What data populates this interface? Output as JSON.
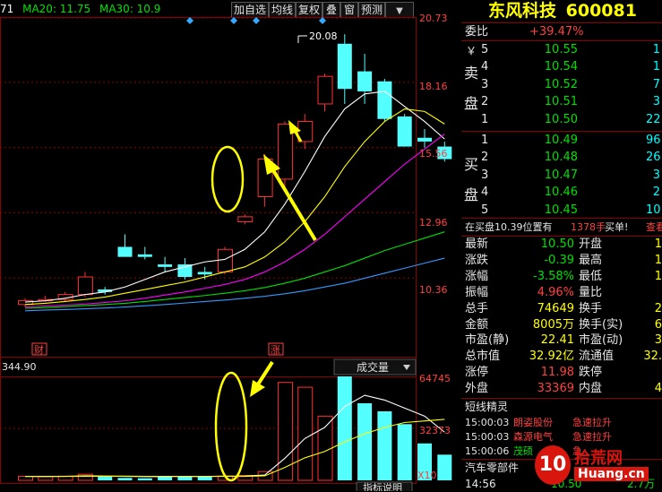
{
  "toolbar": {
    "ma_prefix": "71",
    "ma20": "MA20: 11.75",
    "ma30": "MA30: 10.9",
    "buttons": [
      "加自选",
      "均线",
      "复权",
      "叠",
      "窗",
      "预测"
    ],
    "dropdown_icon": "triangle-down-icon"
  },
  "price_axis": [
    "20.73",
    "18.16",
    "15.56",
    "12.96",
    "10.36"
  ],
  "high_label": "20.08",
  "markers": {
    "cai": "财",
    "zhang": "涨"
  },
  "volume": {
    "left_value": "344.90",
    "indicator": "成交量",
    "axis": [
      "64745",
      "32373",
      "X10"
    ],
    "bottom_tab": "指标说明"
  },
  "chart_data": {
    "type": "candlestick",
    "ohlc": [
      [
        9.3,
        9.55,
        9.2,
        9.45
      ],
      [
        9.45,
        9.65,
        9.4,
        9.5
      ],
      [
        9.5,
        9.8,
        9.4,
        9.7
      ],
      [
        9.7,
        10.6,
        9.6,
        10.4
      ],
      [
        9.9,
        10.0,
        9.7,
        9.8
      ],
      [
        11.6,
        12.1,
        11.3,
        11.2
      ],
      [
        11.3,
        11.6,
        11.1,
        11.2
      ],
      [
        10.9,
        11.2,
        10.6,
        10.8
      ],
      [
        10.9,
        11.15,
        10.3,
        10.4
      ],
      [
        10.6,
        10.8,
        10.3,
        10.5
      ],
      [
        10.6,
        11.6,
        10.5,
        11.5
      ],
      [
        12.6,
        12.9,
        12.5,
        12.8
      ],
      [
        13.6,
        15.3,
        13.2,
        15.1
      ],
      [
        14.3,
        16.6,
        13.9,
        16.5
      ],
      [
        15.8,
        16.9,
        15.5,
        16.6
      ],
      [
        17.3,
        18.5,
        17.0,
        18.4
      ],
      [
        19.7,
        20.08,
        17.3,
        17.9
      ],
      [
        18.6,
        19.3,
        17.3,
        17.8
      ],
      [
        18.2,
        18.3,
        16.6,
        16.7
      ],
      [
        16.8,
        16.9,
        15.6,
        15.6
      ],
      [
        15.95,
        16.3,
        15.55,
        15.8
      ],
      [
        15.6,
        15.8,
        15.0,
        15.1
      ]
    ],
    "volume": [
      2500,
      2300,
      2600,
      3800,
      2200,
      1500,
      1300,
      2800,
      2700,
      2500,
      2600,
      3000,
      5500,
      61000,
      58000,
      40000,
      64745,
      48000,
      43000,
      35000,
      23000,
      16000
    ],
    "ma_price": [
      {
        "name": "MA5",
        "color": "#ffffff",
        "values": [
          9.4,
          9.45,
          9.55,
          9.7,
          9.8,
          10.0,
          10.3,
          10.6,
          10.8,
          11.0,
          11.1,
          11.5,
          12.2,
          13.3,
          14.6,
          16.0,
          17.1,
          17.7,
          17.8,
          17.2,
          16.6,
          15.9
        ]
      },
      {
        "name": "MA10",
        "color": "#ffff00",
        "values": [
          9.3,
          9.35,
          9.42,
          9.5,
          9.6,
          9.75,
          9.9,
          10.05,
          10.2,
          10.4,
          10.6,
          10.8,
          11.2,
          11.8,
          12.6,
          13.6,
          14.8,
          15.8,
          16.6,
          17.1,
          17.0,
          16.5
        ]
      },
      {
        "name": "MA20",
        "color": "#ff00ff",
        "values": [
          9.2,
          9.24,
          9.28,
          9.32,
          9.38,
          9.45,
          9.55,
          9.68,
          9.8,
          9.95,
          10.1,
          10.3,
          10.6,
          11.0,
          11.5,
          12.1,
          12.8,
          13.5,
          14.2,
          14.9,
          15.5,
          16.1
        ]
      },
      {
        "name": "MA30",
        "color": "#00e000",
        "values": [
          9.15,
          9.18,
          9.22,
          9.26,
          9.3,
          9.35,
          9.42,
          9.5,
          9.58,
          9.66,
          9.75,
          9.85,
          9.98,
          10.15,
          10.35,
          10.6,
          10.85,
          11.15,
          11.45,
          11.7,
          11.95,
          12.2
        ]
      },
      {
        "name": "MA60",
        "color": "#3399ff",
        "values": [
          9.05,
          9.08,
          9.1,
          9.13,
          9.16,
          9.2,
          9.25,
          9.3,
          9.36,
          9.42,
          9.48,
          9.55,
          9.63,
          9.73,
          9.85,
          10.0,
          10.15,
          10.35,
          10.55,
          10.75,
          10.95,
          11.15
        ]
      }
    ],
    "ma_volume": [
      {
        "name": "VMA5",
        "color": "#ffffff",
        "values": [
          2500,
          2450,
          2500,
          2800,
          2700,
          2500,
          2300,
          2300,
          2500,
          2400,
          2600,
          2700,
          3300,
          13700,
          26000,
          33000,
          46000,
          53000,
          50000,
          45000,
          40000,
          30000
        ]
      },
      {
        "name": "VMA10",
        "color": "#ffff00",
        "values": [
          2400,
          2400,
          2450,
          2500,
          2550,
          2600,
          2500,
          2450,
          2450,
          2450,
          2450,
          2500,
          2800,
          8000,
          14000,
          18000,
          24000,
          29000,
          33000,
          36000,
          37000,
          38000
        ]
      }
    ]
  },
  "quote": {
    "name": "东风科技",
    "code": "600081",
    "weibi_label": "委比",
    "weibi_value": "+39.47%",
    "sell_side": [
      "卖",
      "盘"
    ],
    "buy_side": [
      "买",
      "盘"
    ],
    "sells": [
      {
        "n": "5",
        "price": "10.55",
        "vol": "1"
      },
      {
        "n": "4",
        "price": "10.54",
        "vol": "1"
      },
      {
        "n": "3",
        "price": "10.52",
        "vol": "7"
      },
      {
        "n": "2",
        "price": "10.51",
        "vol": "3"
      },
      {
        "n": "1",
        "price": "10.50",
        "vol": "22"
      }
    ],
    "buys": [
      {
        "n": "1",
        "price": "10.49",
        "vol": "96"
      },
      {
        "n": "2",
        "price": "10.48",
        "vol": "26"
      },
      {
        "n": "3",
        "price": "10.47",
        "vol": "3"
      },
      {
        "n": "4",
        "price": "10.46",
        "vol": "2"
      },
      {
        "n": "5",
        "price": "10.45",
        "vol": "10"
      }
    ],
    "yen_sign": "￥",
    "alert_text": "在买盘10.39位置有",
    "alert_vol": "1378手",
    "alert_action": "买单!",
    "alert_link": "查看",
    "stats": [
      {
        "l": "最新",
        "v": "10.50",
        "r": "开盘",
        "rv": "1"
      },
      {
        "l": "涨跌",
        "v": "-0.39",
        "r": "最高",
        "rv": "1"
      },
      {
        "l": "涨幅",
        "v": "-3.58%",
        "r": "最低",
        "rv": "1"
      },
      {
        "l": "振幅",
        "v": "4.96%",
        "r": "量比",
        "rv": ""
      },
      {
        "l": "总手",
        "v": "74649",
        "r": "换手",
        "rv": "2"
      },
      {
        "l": "金额",
        "v": "8005万",
        "r": "换手(实)",
        "rv": "6"
      },
      {
        "l": "市盈(静)",
        "v": "22.41",
        "r": "市盈(动)",
        "rv": "3"
      },
      {
        "l": "总市值",
        "v": "32.92亿",
        "r": "流通值",
        "rv": "32."
      },
      {
        "l": "涨停",
        "v": "11.98",
        "r": "跌停",
        "rv": ""
      },
      {
        "l": "外盘",
        "v": "33369",
        "r": "内盘",
        "rv": "4"
      }
    ],
    "spirit_title": "短线精灵",
    "spirit": [
      {
        "time": "15:00:03",
        "name": "朗姿股份",
        "event": "急速拉升"
      },
      {
        "time": "15:00:03",
        "name": "森源电气",
        "event": "急速拉升"
      },
      {
        "time": "15:00:06",
        "name": "茂硕",
        "event": "急"
      }
    ],
    "sector": "汽车零部件",
    "last_time": "14:56",
    "last_price": "10.50",
    "last_extra": "2.7万",
    "watermark": "拾荒网",
    "watermark_domain": "Huang.cn",
    "watermark_num": "10"
  }
}
